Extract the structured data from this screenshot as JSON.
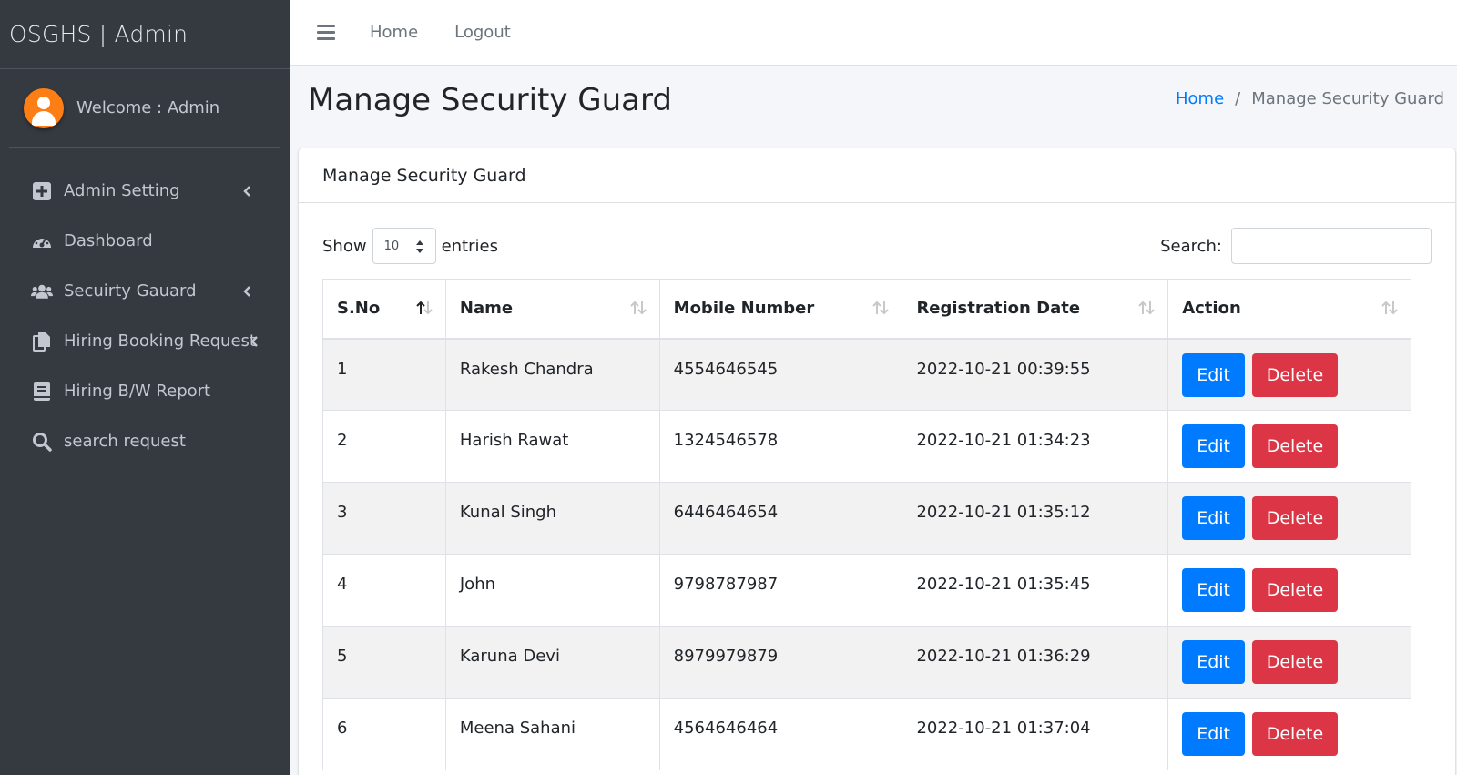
{
  "brand": "OSGHS | Admin",
  "user": {
    "welcome": "Welcome : Admin",
    "avatar_color": "#fd7e14"
  },
  "sidebar": {
    "items": [
      {
        "label": "Admin Setting",
        "icon": "plus-square-icon",
        "has_submenu": true
      },
      {
        "label": "Dashboard",
        "icon": "tachometer-icon",
        "has_submenu": false
      },
      {
        "label": "Secuirty Gauard",
        "icon": "users-icon",
        "has_submenu": true
      },
      {
        "label": "Hiring Booking Request",
        "icon": "file-copy-icon",
        "has_submenu": true
      },
      {
        "label": "Hiring B/W Report",
        "icon": "book-icon",
        "has_submenu": false
      },
      {
        "label": "search request",
        "icon": "search-icon",
        "has_submenu": false
      }
    ]
  },
  "topnav": {
    "home": "Home",
    "logout": "Logout"
  },
  "header": {
    "title": "Manage Security Guard"
  },
  "breadcrumb": {
    "home": "Home",
    "sep": "/",
    "active": "Manage Security Guard"
  },
  "card": {
    "title": "Manage Security Guard"
  },
  "controls": {
    "show": "Show",
    "entries_value": "10",
    "entries": "entries",
    "search_label": "Search:",
    "search_value": ""
  },
  "table": {
    "headers": [
      "S.No",
      "Name",
      "Mobile Number",
      "Registration Date",
      "Action"
    ],
    "rows": [
      {
        "sno": "1",
        "name": "Rakesh Chandra",
        "mobile": "4554646545",
        "date": "2022-10-21 00:39:55"
      },
      {
        "sno": "2",
        "name": "Harish Rawat",
        "mobile": "1324546578",
        "date": "2022-10-21 01:34:23"
      },
      {
        "sno": "3",
        "name": "Kunal Singh",
        "mobile": "6446464654",
        "date": "2022-10-21 01:35:12"
      },
      {
        "sno": "4",
        "name": "John",
        "mobile": "9798787987",
        "date": "2022-10-21 01:35:45"
      },
      {
        "sno": "5",
        "name": "Karuna Devi",
        "mobile": "8979979879",
        "date": "2022-10-21 01:36:29"
      },
      {
        "sno": "6",
        "name": "Meena Sahani",
        "mobile": "4564646464",
        "date": "2022-10-21 01:37:04"
      }
    ],
    "edit_label": "Edit",
    "delete_label": "Delete"
  },
  "colors": {
    "sidebar": "#343a40",
    "primary": "#007bff",
    "danger": "#dc3545"
  }
}
